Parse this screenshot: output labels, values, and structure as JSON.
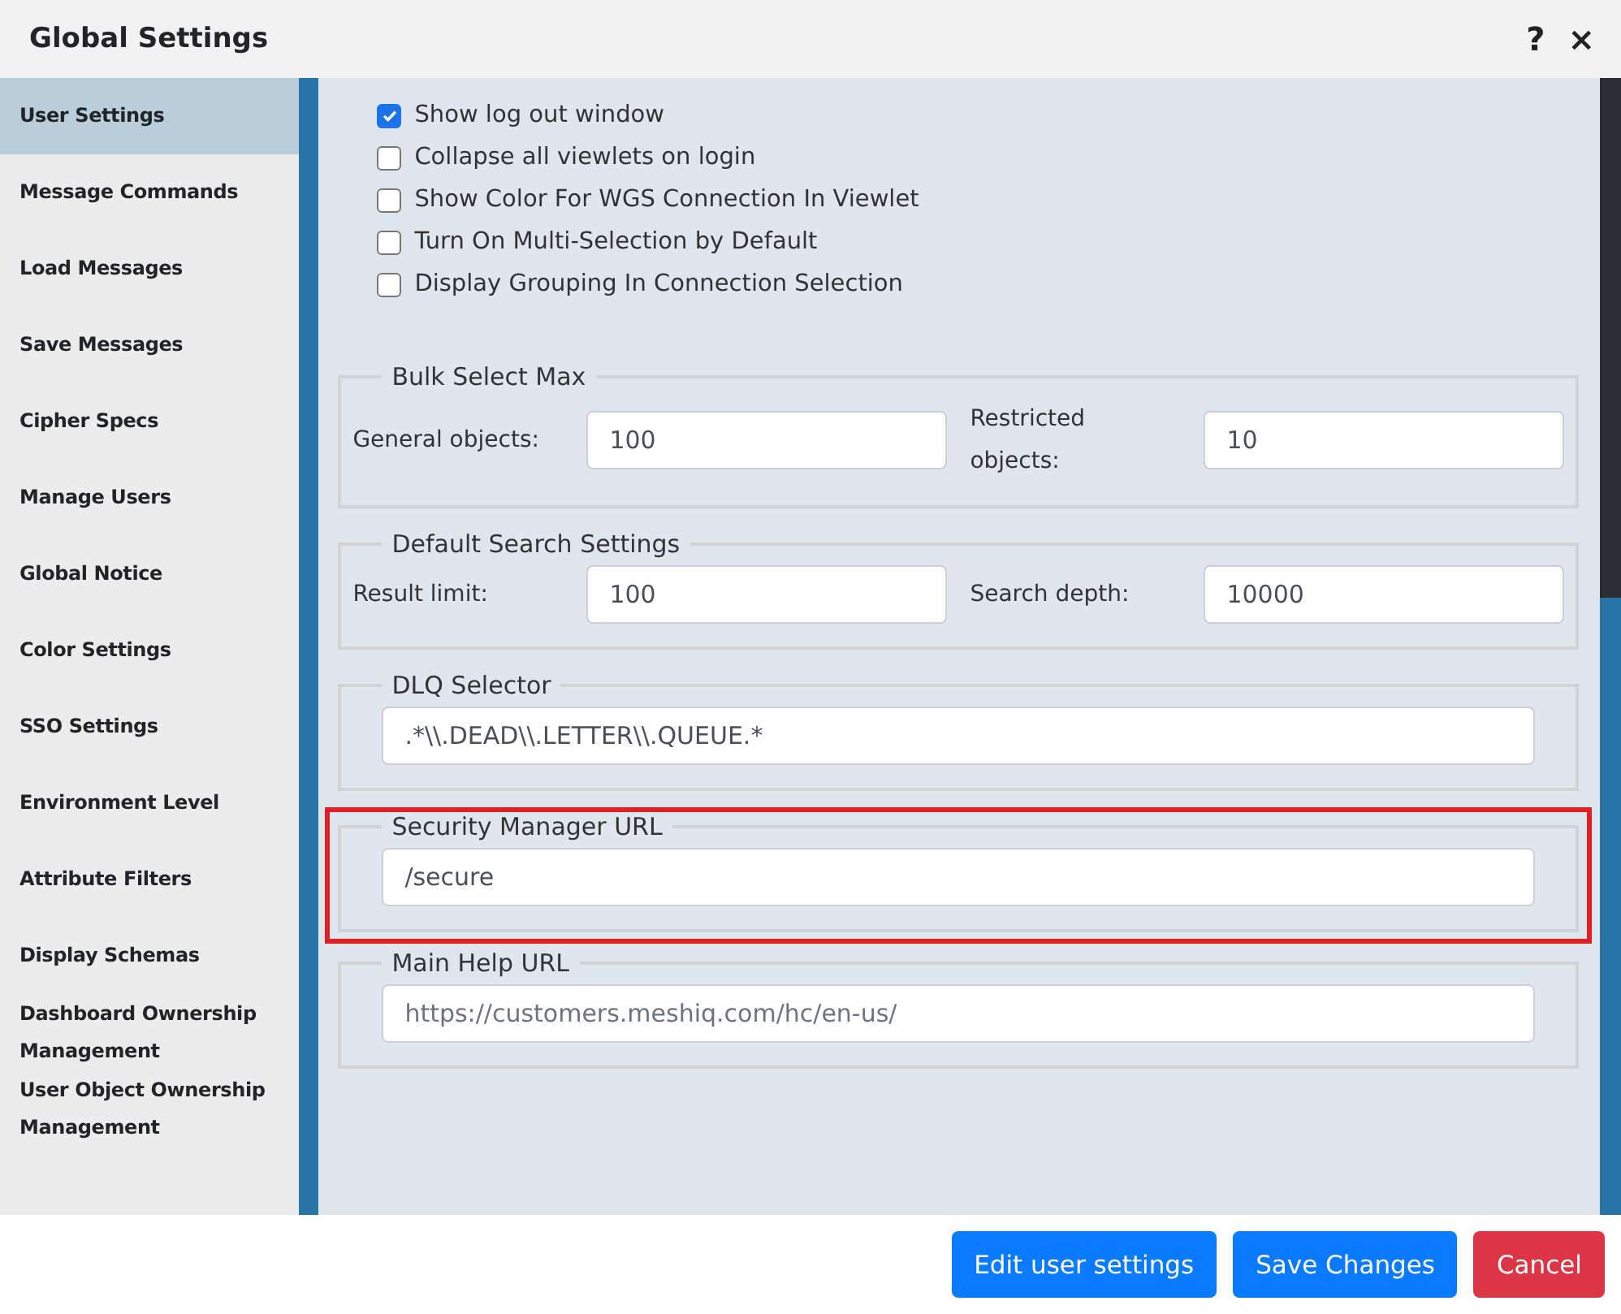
{
  "window": {
    "title": "Global Settings",
    "help": "?",
    "close": "×"
  },
  "sidebar": {
    "items": [
      {
        "label": "User Settings",
        "selected": true
      },
      {
        "label": "Message Commands",
        "selected": false
      },
      {
        "label": "Load Messages",
        "selected": false
      },
      {
        "label": "Save Messages",
        "selected": false
      },
      {
        "label": "Cipher Specs",
        "selected": false
      },
      {
        "label": "Manage Users",
        "selected": false
      },
      {
        "label": "Global Notice",
        "selected": false
      },
      {
        "label": "Color Settings",
        "selected": false
      },
      {
        "label": "SSO Settings",
        "selected": false
      },
      {
        "label": "Environment Level",
        "selected": false
      },
      {
        "label": "Attribute Filters",
        "selected": false
      },
      {
        "label": "Display Schemas",
        "selected": false
      },
      {
        "label": "Dashboard Ownership Management",
        "selected": false
      },
      {
        "label": "User Object Ownership Management",
        "selected": false
      }
    ]
  },
  "checkboxes": [
    {
      "label": "Show log out window",
      "checked": true
    },
    {
      "label": "Collapse all viewlets on login",
      "checked": false
    },
    {
      "label": "Show Color For WGS Connection In Viewlet",
      "checked": false
    },
    {
      "label": "Turn On Multi-Selection by Default",
      "checked": false
    },
    {
      "label": "Display Grouping In Connection Selection",
      "checked": false
    }
  ],
  "sections": [
    {
      "legend": "Bulk Select Max",
      "highlighted": false,
      "fields": [
        {
          "label": "General objects:",
          "value": "100"
        },
        {
          "label": "Restricted objects:",
          "value": "10"
        }
      ]
    },
    {
      "legend": "Default Search Settings",
      "highlighted": false,
      "fields": [
        {
          "label": "Result limit:",
          "value": "100"
        },
        {
          "label": "Search depth:",
          "value": "10000"
        }
      ]
    },
    {
      "legend": "DLQ Selector",
      "highlighted": false,
      "fields": [
        {
          "value": ".*\\\\.DEAD\\\\.LETTER\\\\.QUEUE.*"
        }
      ]
    },
    {
      "legend": "Security Manager URL",
      "highlighted": true,
      "fields": [
        {
          "value": "/secure"
        }
      ]
    },
    {
      "legend": "Main Help URL",
      "highlighted": false,
      "fields": [
        {
          "placeholder": "https://customers.meshiq.com/hc/en-us/"
        }
      ]
    }
  ],
  "buttons": [
    {
      "label": "Edit user settings",
      "kind": "primary"
    },
    {
      "label": "Save Changes",
      "kind": "primary"
    },
    {
      "label": "Cancel",
      "kind": "danger"
    }
  ]
}
